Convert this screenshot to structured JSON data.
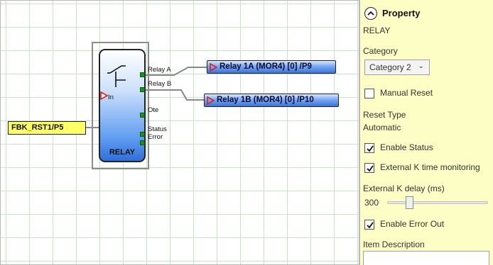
{
  "diagram": {
    "input_block": {
      "label": "FBK_RST1/P5"
    },
    "relay_block": {
      "title": "RELAY",
      "input_port": "In",
      "ports": {
        "relay_a": "Relay A",
        "relay_b": "Relay B",
        "ote": "Ote",
        "status": "Status",
        "error": "Error"
      }
    },
    "outputs": [
      {
        "label": "Relay 1A (MOR4) [0] /P9"
      },
      {
        "label": "Relay 1B (MOR4) [0] /P10"
      }
    ]
  },
  "property_panel": {
    "title": "Property",
    "item_name": "RELAY",
    "category": {
      "label": "Category",
      "value": "Category 2"
    },
    "manual_reset": {
      "label": "Manual Reset",
      "checked": false
    },
    "reset_type": {
      "label": "Reset Type",
      "value": "Automatic"
    },
    "enable_status": {
      "label": "Enable Status",
      "checked": true
    },
    "external_k": {
      "label": "External K time monitoring",
      "checked": true
    },
    "external_k_delay": {
      "label": "External K delay (ms)",
      "value": "300"
    },
    "enable_error_out": {
      "label": "Enable Error Out",
      "checked": true
    },
    "item_description": {
      "label": "Item Description",
      "value": ""
    }
  },
  "colors": {
    "grid": "#c9e3c9",
    "panel_bg": "#fdfdc6",
    "input_block_bg": "#ffff66",
    "port": "#1f8f1f",
    "arrow": "#e0201a"
  }
}
